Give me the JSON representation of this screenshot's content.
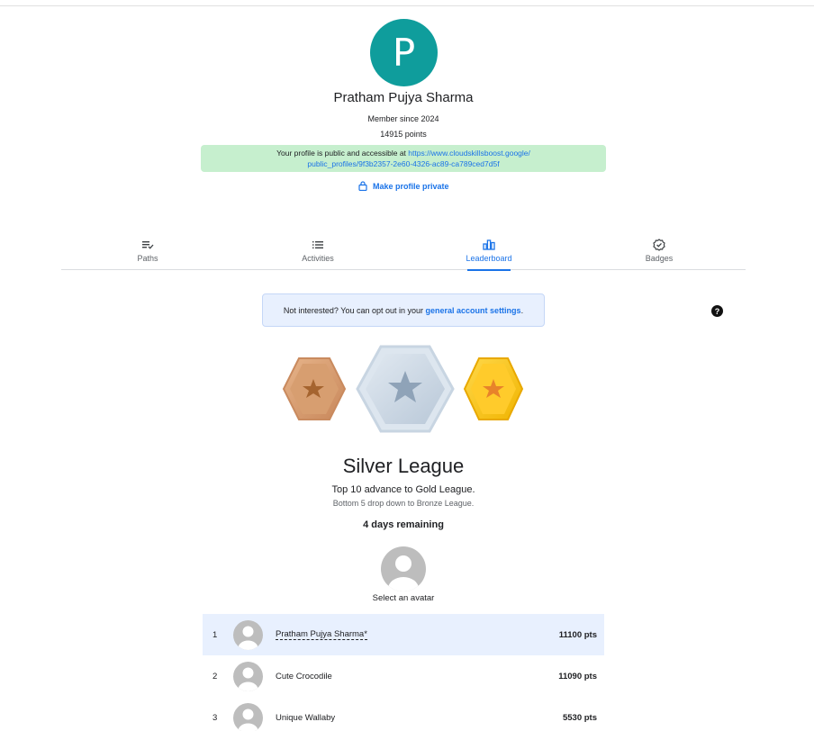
{
  "profile": {
    "initial": "P",
    "name": "Pratham Pujya Sharma",
    "member_since": "Member since 2024",
    "points": "14915 points",
    "public_text": "Your profile is public and accessible at ",
    "public_url": "https://www.cloudskillsboost.google/public_profiles/9f3b2357-2e60-4326-ac89-ca789ced7d5f",
    "make_private": "Make profile private"
  },
  "tabs": [
    {
      "label": "Paths",
      "icon": "paths-icon"
    },
    {
      "label": "Activities",
      "icon": "list-icon"
    },
    {
      "label": "Leaderboard",
      "icon": "bar-chart-icon",
      "active": true
    },
    {
      "label": "Badges",
      "icon": "badge-check-icon"
    }
  ],
  "optout": {
    "prefix": "Not interested? You can opt out in your ",
    "link": "general account settings",
    "suffix": "."
  },
  "help": "?",
  "league": {
    "title": "Silver League",
    "advance": "Top 10 advance to Gold League.",
    "drop": "Bottom 5 drop down to Bronze League.",
    "remaining": "4 days remaining",
    "select_avatar": "Select an avatar"
  },
  "leaderboard": [
    {
      "rank": "1",
      "name": "Pratham Pujya Sharma*",
      "points": "11100 pts",
      "me": true
    },
    {
      "rank": "2",
      "name": "Cute Crocodile",
      "points": "11090 pts"
    },
    {
      "rank": "3",
      "name": "Unique Wallaby",
      "points": "5530 pts"
    }
  ],
  "colors": {
    "avatar_bg": "#0f9d9c",
    "accent": "#1a73e8",
    "public_bg": "#c6efce",
    "bronze": "#d39a6a",
    "silver": "#c9d6e3",
    "gold": "#f6c21c"
  }
}
